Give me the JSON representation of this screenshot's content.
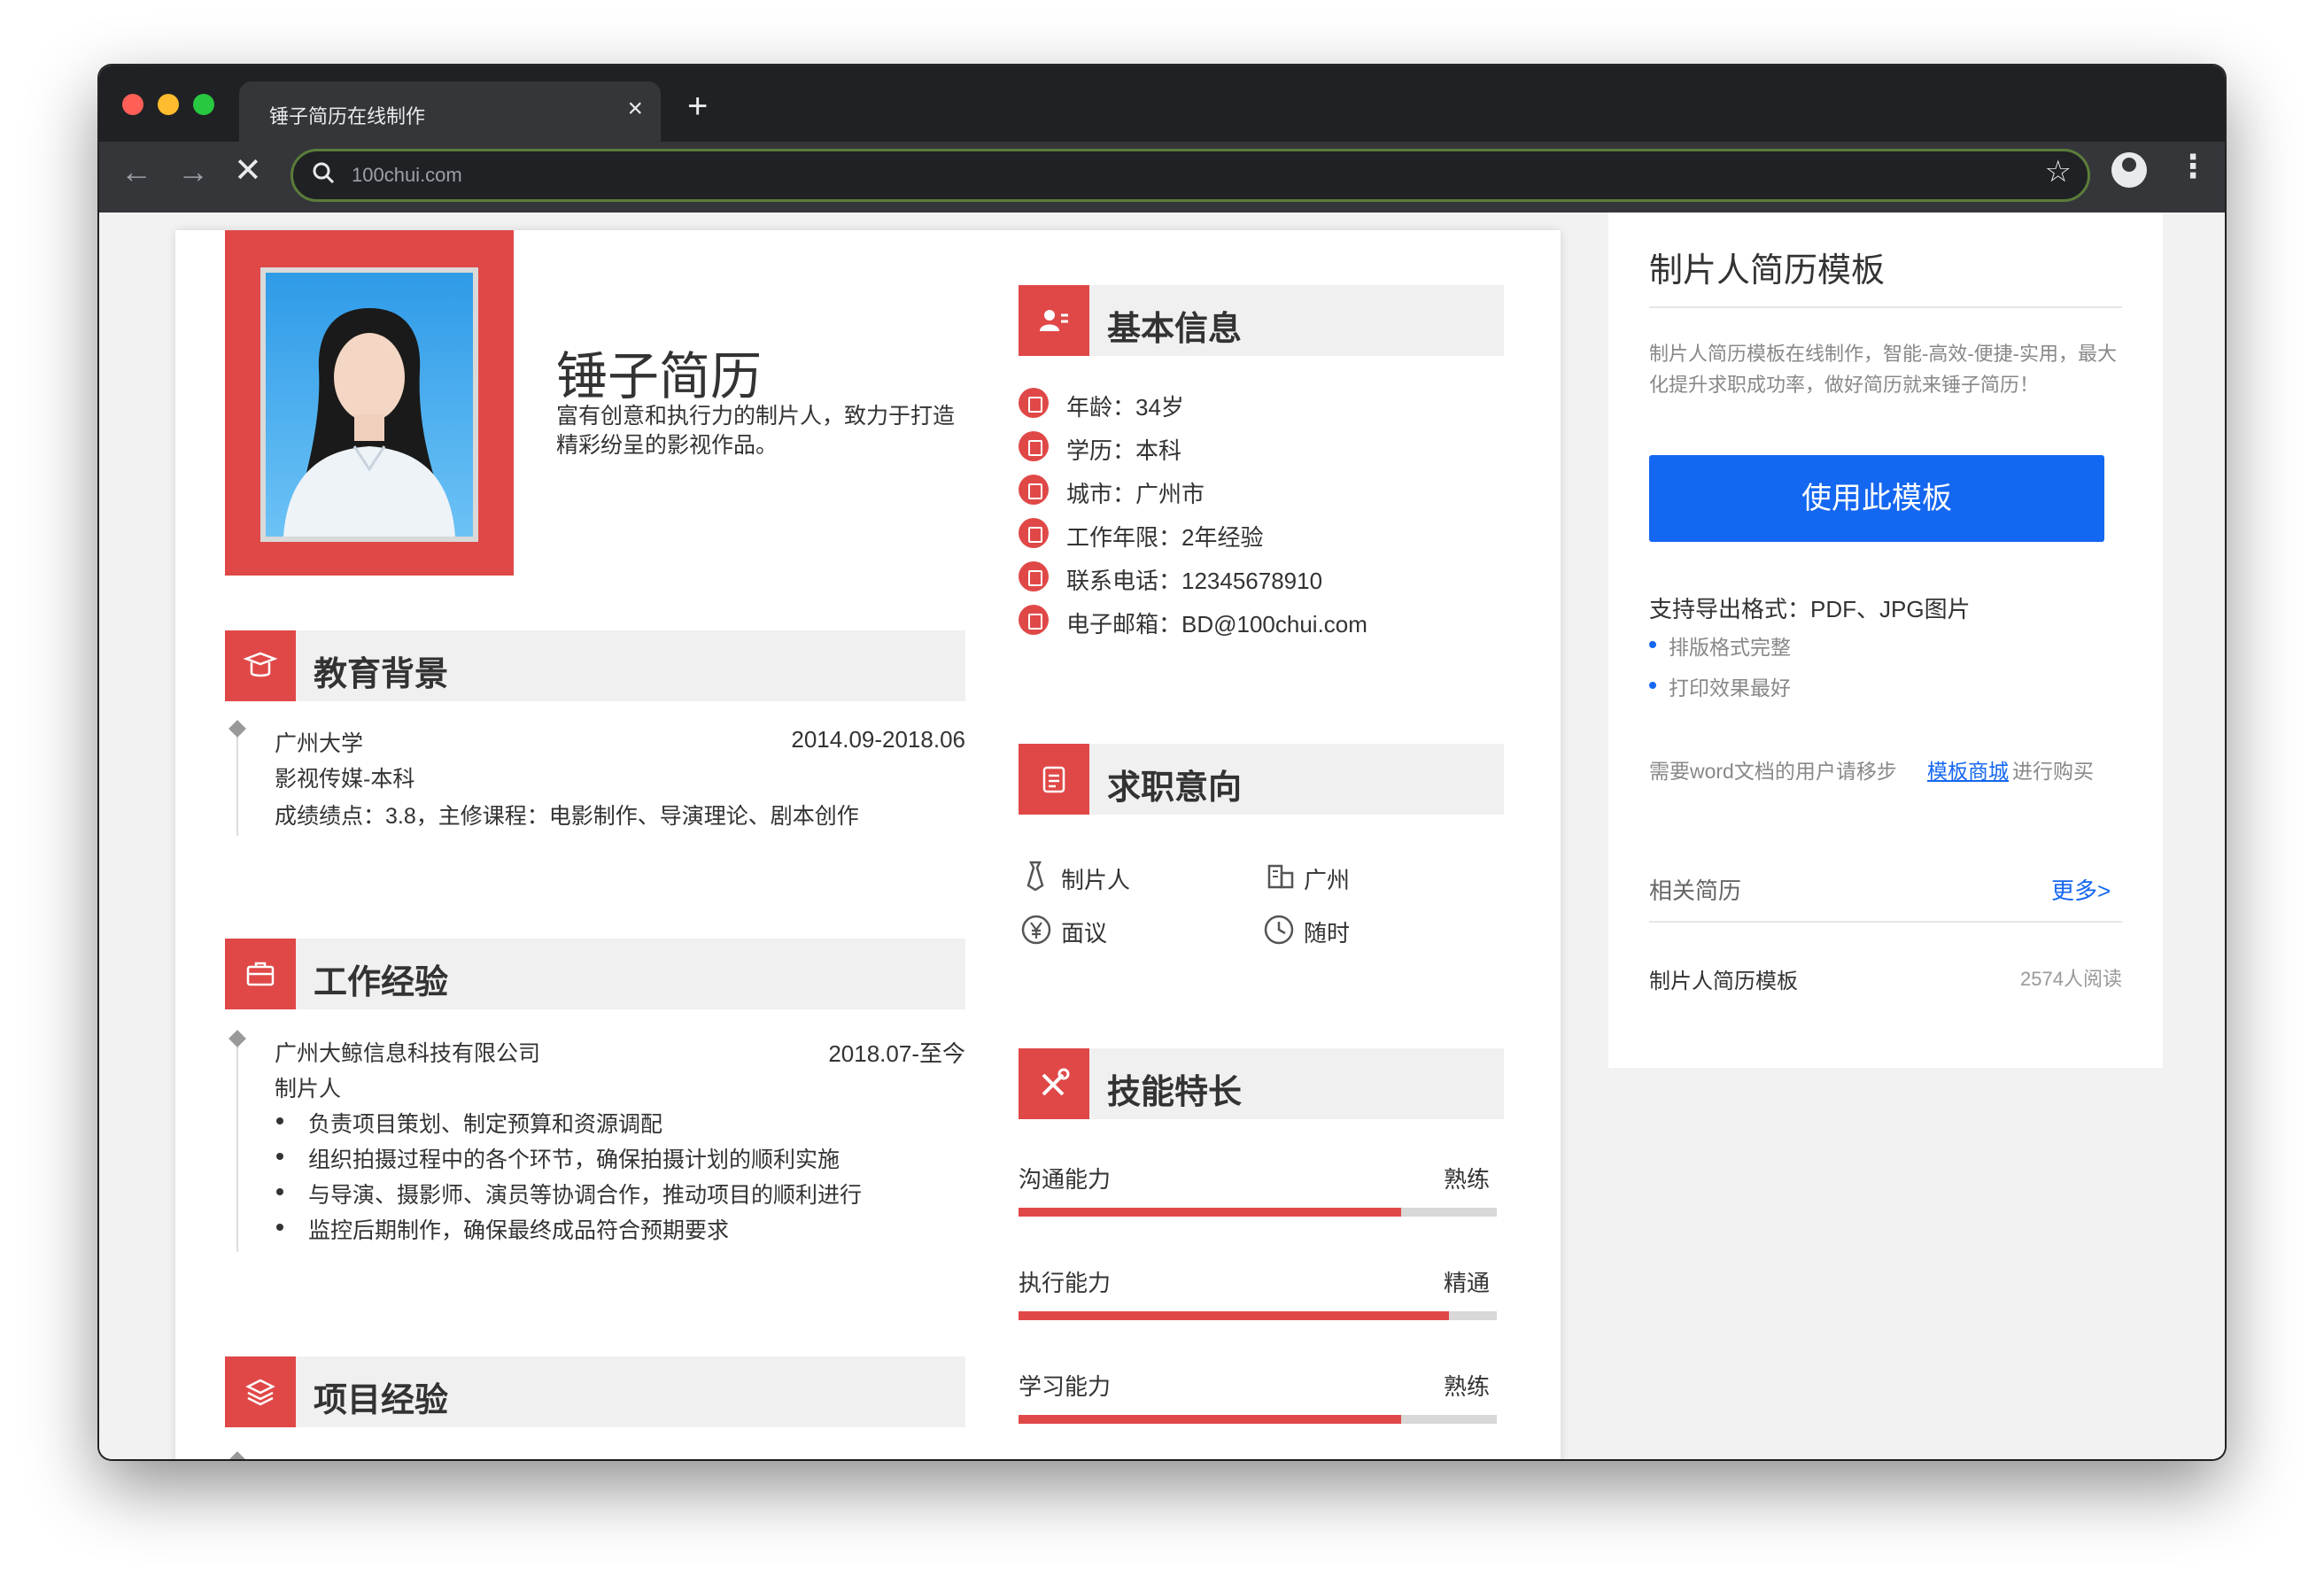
{
  "browser": {
    "tab_title": "锤子简历在线制作",
    "tab_close": "×",
    "new_tab": "+",
    "url": "100chui.com",
    "back": "←",
    "forward": "→",
    "stop": "✕",
    "star": "☆",
    "menu": "⋮"
  },
  "resume": {
    "name": "锤子简历",
    "intro": "富有创意和执行力的制片人，致力于打造精彩纷呈的影视作品。",
    "education": {
      "title": "教育背景",
      "school": "广州大学",
      "period": "2014.09-2018.06",
      "major": "影视传媒-本科",
      "detail": "成绩绩点：3.8，主修课程：电影制作、导演理论、剧本创作"
    },
    "work": {
      "title": "工作经验",
      "company": "广州大鲸信息科技有限公司",
      "period": "2018.07-至今",
      "role": "制片人",
      "duties": [
        "负责项目策划、制定预算和资源调配",
        "组织拍摄过程中的各个环节，确保拍摄计划的顺利实施",
        "与导演、摄影师、演员等协调合作，推动项目的顺利进行",
        "监控后期制作，确保最终成品符合预期要求"
      ]
    },
    "project": {
      "title": "项目经验"
    },
    "basic_info": {
      "title": "基本信息",
      "items": [
        {
          "icon": "calendar-icon",
          "text": "年龄：34岁"
        },
        {
          "icon": "graduation-icon",
          "text": "学历：本科"
        },
        {
          "icon": "building-icon",
          "text": "城市：广州市"
        },
        {
          "icon": "document-icon",
          "text": "工作年限：2年经验"
        },
        {
          "icon": "phone-icon",
          "text": "联系电话：12345678910"
        },
        {
          "icon": "mail-icon",
          "text": "电子邮箱：BD@100chui.com"
        }
      ]
    },
    "intent": {
      "title": "求职意向",
      "position": "制片人",
      "city": "广州",
      "salary": "面议",
      "availability": "随时"
    },
    "skills": {
      "title": "技能特长",
      "items": [
        {
          "name": "沟通能力",
          "level": "熟练",
          "fraction": 0.8
        },
        {
          "name": "执行能力",
          "level": "精通",
          "fraction": 0.9
        },
        {
          "name": "学习能力",
          "level": "熟练",
          "fraction": 0.8
        }
      ]
    }
  },
  "sidebar": {
    "title": "制片人简历模板",
    "description": "制片人简历模板在线制作，智能-高效-便捷-实用，最大化提升求职成功率，做好简历就来锤子简历！",
    "use_button": "使用此模板",
    "formats": "支持导出格式：PDF、JPG图片",
    "features": [
      "排版格式完整",
      "打印效果最好"
    ],
    "note_prefix": "需要word文档的用户请移步",
    "note_link": "模板商城",
    "note_suffix": "进行购买",
    "related_label": "相关简历",
    "more_link": "更多>",
    "related_item": "制片人简历模板",
    "related_reads": "2574人阅读"
  },
  "colors": {
    "accent_red": "#e04848",
    "brand_blue": "#1467f0"
  }
}
